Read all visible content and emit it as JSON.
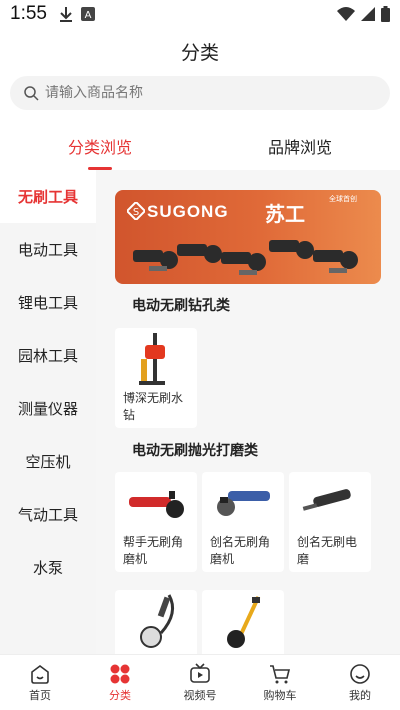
{
  "status": {
    "time": "1:55",
    "icons": [
      "download-icon",
      "keyboard-a-icon",
      "wifi-icon",
      "signal-icon",
      "battery-icon"
    ]
  },
  "page": {
    "title": "分类"
  },
  "search": {
    "placeholder": "请输入商品名称"
  },
  "tabs": [
    {
      "label": "分类浏览",
      "active": true
    },
    {
      "label": "品牌浏览",
      "active": false
    }
  ],
  "sidebar": {
    "items": [
      {
        "label": "无刷工具",
        "active": true
      },
      {
        "label": "电动工具"
      },
      {
        "label": "锂电工具"
      },
      {
        "label": "园林工具"
      },
      {
        "label": "测量仪器"
      },
      {
        "label": "空压机"
      },
      {
        "label": "气动工具"
      },
      {
        "label": "水泵"
      }
    ]
  },
  "banner": {
    "brand": "SUGONG",
    "brand_cn": "苏工",
    "tag": "全球首创"
  },
  "sections": [
    {
      "title": "电动无刷钻孔类",
      "items": [
        {
          "name": "博深无刷水钻"
        }
      ]
    },
    {
      "title": "电动无刷抛光打磨类",
      "items": [
        {
          "name": "帮手无刷角磨机"
        },
        {
          "name": "创名无刷角磨机"
        },
        {
          "name": "创名无刷电磨"
        },
        {
          "name": ""
        },
        {
          "name": ""
        }
      ]
    }
  ],
  "bottom_nav": [
    {
      "label": "首页",
      "icon": "home-icon"
    },
    {
      "label": "分类",
      "icon": "category-icon",
      "active": true
    },
    {
      "label": "视频号",
      "icon": "tv-icon"
    },
    {
      "label": "购物车",
      "icon": "cart-icon"
    },
    {
      "label": "我的",
      "icon": "smile-icon"
    }
  ],
  "colors": {
    "accent": "#e63434",
    "sidebar_bg": "#f5f5f5",
    "banner": "#e06a38"
  }
}
